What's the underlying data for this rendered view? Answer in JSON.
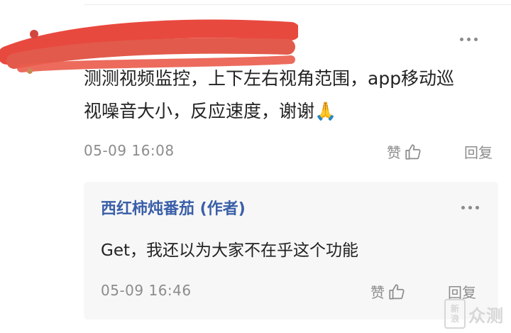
{
  "comment": {
    "text": "测测视频监控，上下左右视角范围，app移动巡\n视噪音大小，反应速度，谢谢🙏",
    "time": "05-09 16:08",
    "like_label": "赞",
    "reply_label": "回复"
  },
  "reply": {
    "author": "西红柿炖番茄 (作者)",
    "text": "Get，我还以为大家不在乎这个功能",
    "time": "05-09 16:46",
    "like_label": "赞",
    "reply_label": "回复"
  },
  "watermark": {
    "badge_line1": "新",
    "badge_line2": "浪",
    "text": "众测"
  },
  "colors": {
    "author": "#3a5fa8",
    "meta": "#8c8c8c",
    "redaction": "#e8493f"
  },
  "icons": [
    "more-icon",
    "thumb-up-icon"
  ]
}
